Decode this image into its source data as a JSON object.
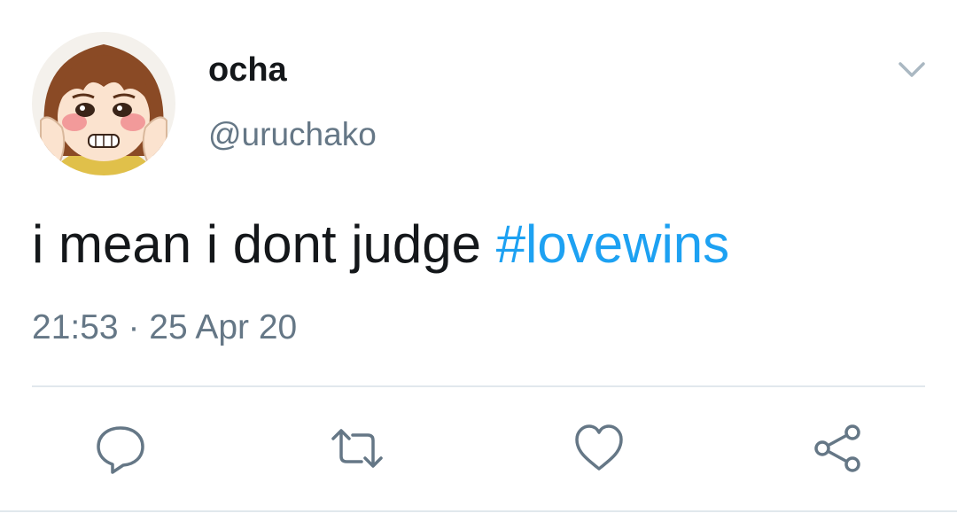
{
  "tweet": {
    "author": {
      "display_name": "ocha",
      "handle": "@uruchako",
      "avatar_icon": "anime-avatar"
    },
    "text": "i mean i dont judge ",
    "hashtag": "#lovewins",
    "time": "21:53",
    "separator": " · ",
    "date": "25 Apr 20"
  },
  "actions": [
    {
      "name": "reply",
      "icon": "comment-icon"
    },
    {
      "name": "retweet",
      "icon": "retweet-icon"
    },
    {
      "name": "like",
      "icon": "heart-icon"
    },
    {
      "name": "share",
      "icon": "share-icon"
    }
  ],
  "colors": {
    "text": "#14171a",
    "secondary": "#657786",
    "link": "#1da1f2",
    "divider": "#e1e8ed"
  }
}
